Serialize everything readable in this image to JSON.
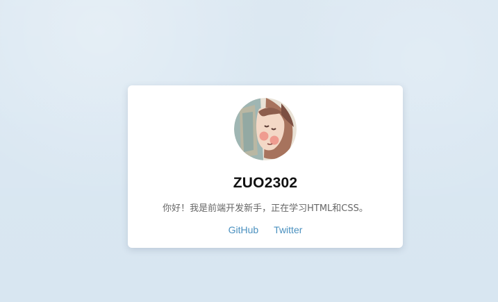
{
  "profile": {
    "avatar_icon": "illustrated-girl-avatar",
    "username": "ZUO2302",
    "bio": "你好！我是前端开发新手，正在学习HTML和CSS。"
  },
  "links": [
    {
      "label": "GitHub"
    },
    {
      "label": "Twitter"
    }
  ],
  "colors": {
    "background": "#d8e6f1",
    "card": "#ffffff",
    "link": "#4a90bf",
    "username": "#111111",
    "bio": "#666666"
  }
}
